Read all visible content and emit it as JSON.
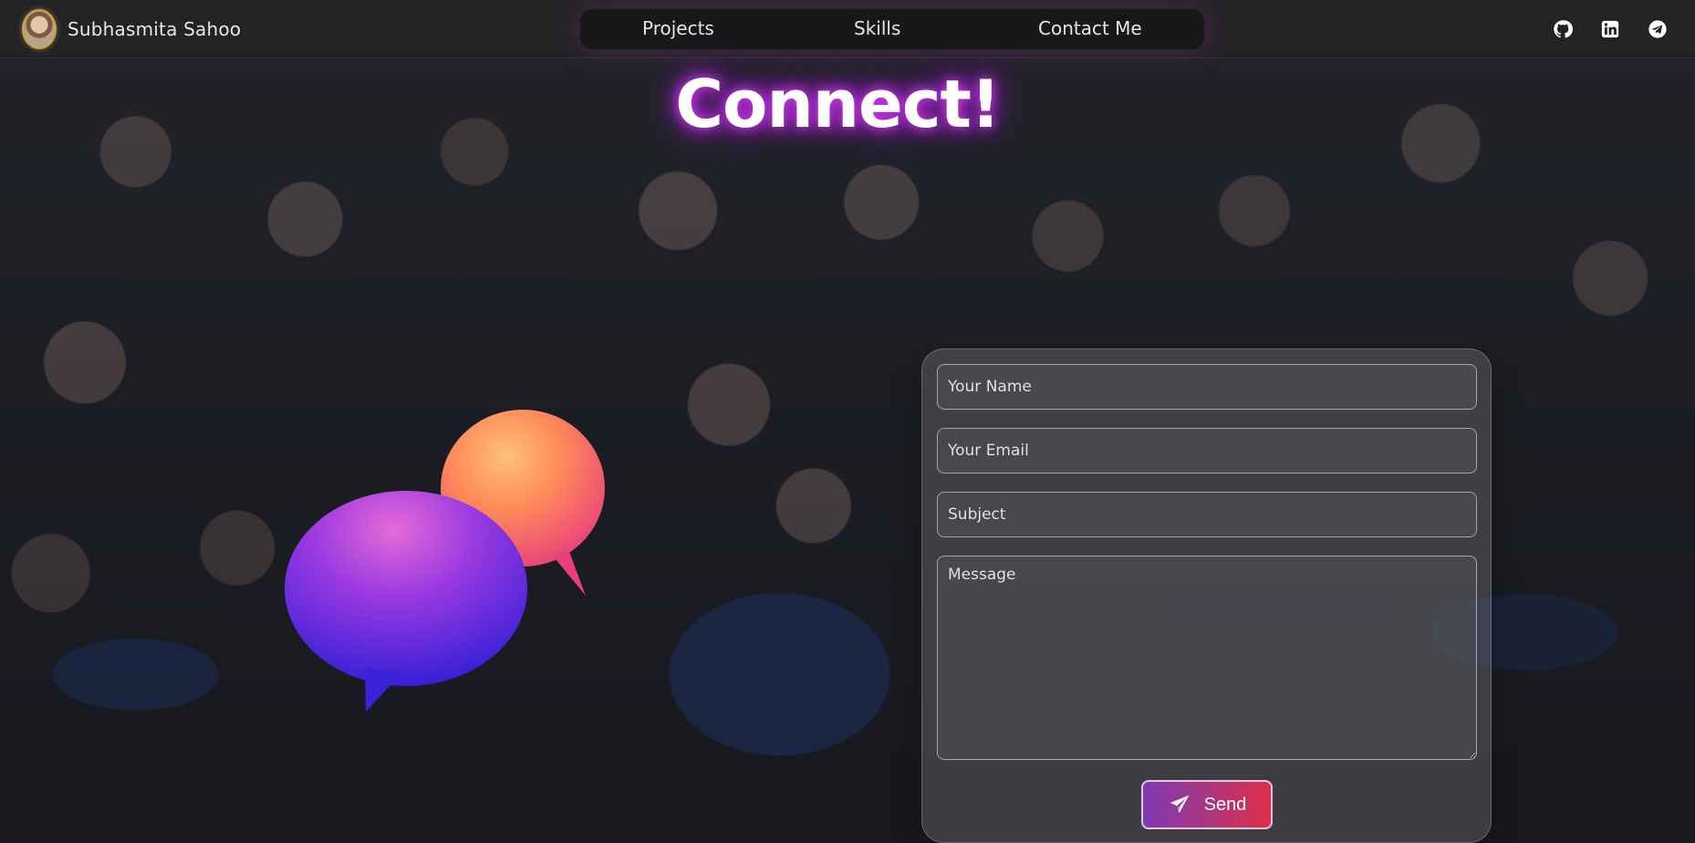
{
  "brand": {
    "name": "Subhasmita Sahoo"
  },
  "nav": {
    "links": [
      {
        "label": "Projects"
      },
      {
        "label": "Skills"
      },
      {
        "label": "Contact Me"
      }
    ],
    "icons": [
      "github-icon",
      "linkedin-icon",
      "telegram-icon"
    ]
  },
  "heading": {
    "title": "Connect!"
  },
  "form": {
    "name_placeholder": "Your Name",
    "email_placeholder": "Your Email",
    "subject_placeholder": "Subject",
    "message_placeholder": "Message",
    "send_label": "Send"
  },
  "colors": {
    "accent_glow": "#d23bf0",
    "send_gradient_start": "#7e3bb3",
    "send_gradient_end": "#e02e48"
  }
}
